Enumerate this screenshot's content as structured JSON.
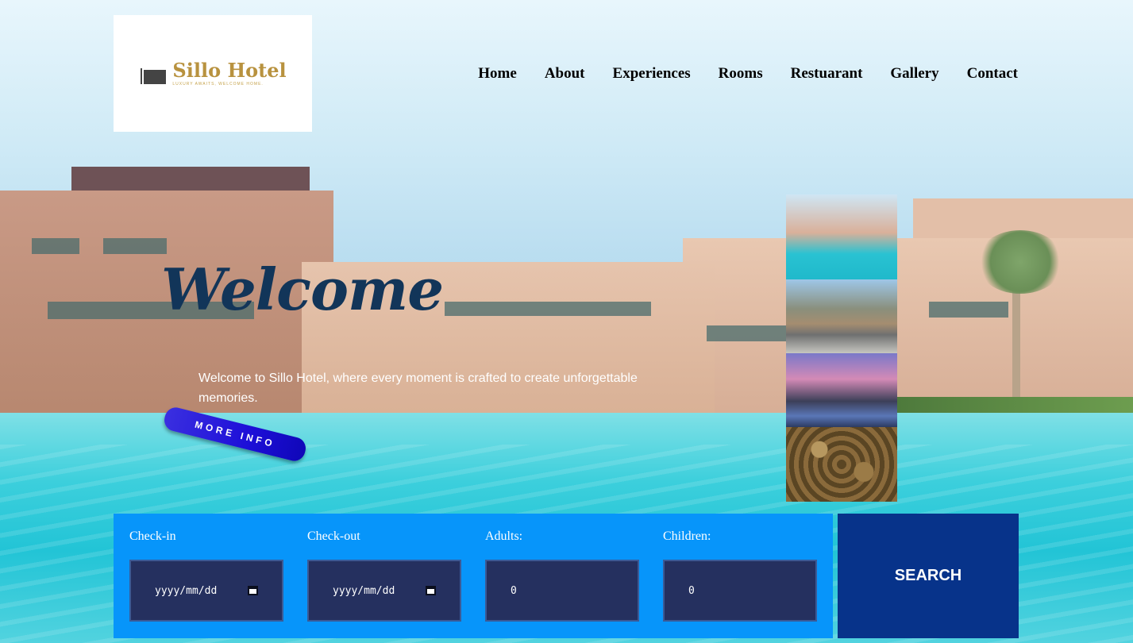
{
  "logo": {
    "name": "Sillo Hotel",
    "tagline": "LUXURY AWAITS, WELCOME HOME."
  },
  "nav": {
    "items": [
      "Home",
      "About",
      "Experiences",
      "Rooms",
      "Restuarant",
      "Gallery",
      "Contact"
    ]
  },
  "hero": {
    "heading": "Welcome",
    "text": "Welcome to Sillo Hotel, where every moment is crafted to create unforgettable memories.",
    "more_button": "MORE INFO"
  },
  "booking": {
    "checkin_label": "Check-in",
    "checkin_value": "yyyy/mm/dd",
    "checkout_label": "Check-out",
    "checkout_value": "yyyy/mm/dd",
    "adults_label": "Adults:",
    "adults_value": "0",
    "children_label": "Children:",
    "children_value": "0",
    "search_button": "SEARCH"
  },
  "colors": {
    "booking_bg": "#0795fa",
    "field_bg": "#25305f",
    "search_bg": "#07338a",
    "heading": "#123559",
    "logo_gold": "#b8923f"
  }
}
